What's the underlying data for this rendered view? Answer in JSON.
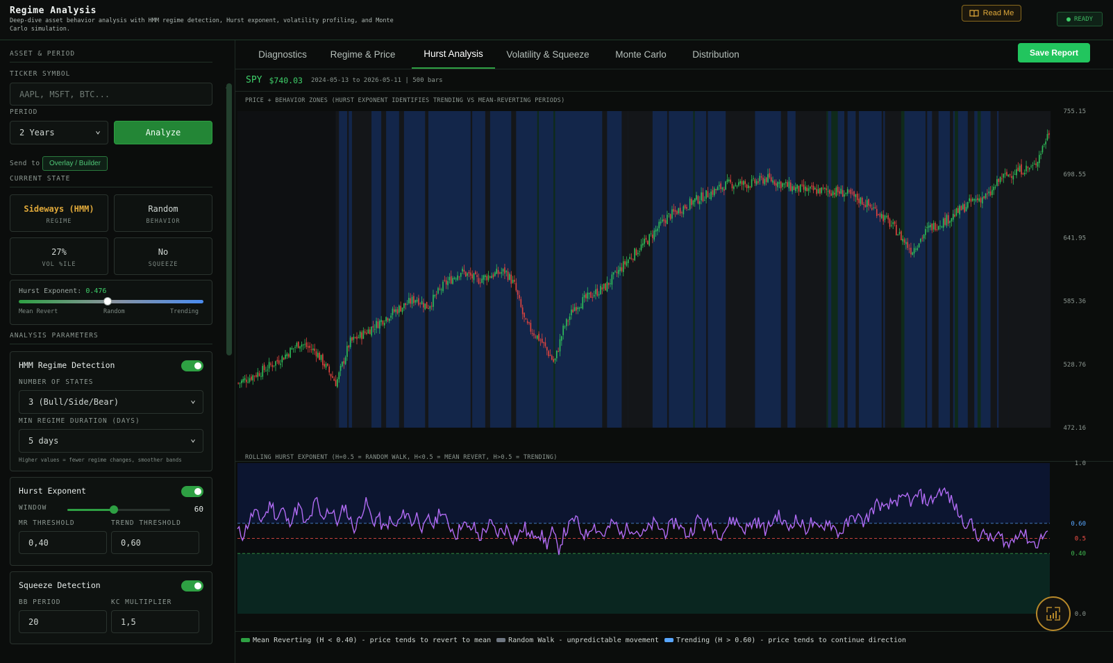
{
  "header": {
    "title": "Regime Analysis",
    "subtitle": "Deep-dive asset behavior analysis with HMM regime detection, Hurst exponent, volatility profiling, and Monte Carlo simulation.",
    "readme_label": "Read Me",
    "status_label": "READY"
  },
  "sidebar": {
    "asset_section": "ASSET & PERIOD",
    "ticker_label": "TICKER SYMBOL",
    "ticker_placeholder": "AAPL, MSFT, BTC...",
    "period_label": "PERIOD",
    "period_value": "2 Years",
    "analyze_label": "Analyze",
    "send_to_label": "Send to",
    "send_to_chip": "Overlay / Builder",
    "state_section": "CURRENT STATE",
    "state_cards": [
      {
        "value": "Sideways (HMM)",
        "label": "REGIME",
        "color": "#e0a93a"
      },
      {
        "value": "Random",
        "label": "BEHAVIOR",
        "color": "#cfd6d2"
      },
      {
        "value": "27%",
        "label": "VOL %ILE",
        "color": "#cfd6d2"
      },
      {
        "value": "No",
        "label": "SQUEEZE",
        "color": "#cfd6d2"
      }
    ],
    "hurst_gauge": {
      "label": "Hurst Exponent:",
      "value": "0.476",
      "position": 0.476,
      "left_label": "Mean Revert",
      "mid_label": "Random",
      "right_label": "Trending"
    },
    "params_section": "ANALYSIS PARAMETERS",
    "hmm": {
      "title": "HMM Regime Detection",
      "enabled": true,
      "states_label": "NUMBER OF STATES",
      "states_value": "3 (Bull/Side/Bear)",
      "duration_label": "MIN REGIME DURATION (DAYS)",
      "duration_value": "5 days",
      "hint": "Higher values = fewer regime changes, smoother bands"
    },
    "hurst": {
      "title": "Hurst Exponent",
      "enabled": true,
      "window_label": "WINDOW",
      "window_value": "60",
      "window_fraction": 0.45,
      "mr_label": "MR THRESHOLD",
      "mr_value": "0,40",
      "trend_label": "TREND THRESHOLD",
      "trend_value": "0,60"
    },
    "squeeze": {
      "title": "Squeeze Detection",
      "enabled": true,
      "bb_label": "BB PERIOD",
      "bb_value": "20",
      "kc_label": "KC MULTIPLIER",
      "kc_value": "1,5"
    }
  },
  "tabs": [
    {
      "label": "Diagnostics",
      "active": false
    },
    {
      "label": "Regime & Price",
      "active": false
    },
    {
      "label": "Hurst Analysis",
      "active": true
    },
    {
      "label": "Volatility & Squeeze",
      "active": false
    },
    {
      "label": "Monte Carlo",
      "active": false
    },
    {
      "label": "Distribution",
      "active": false
    }
  ],
  "save_label": "Save Report",
  "info": {
    "ticker": "SPY",
    "price": "$740.03",
    "range": "2024-05-13 to 2026-05-11 | 500 bars"
  },
  "legend": {
    "items": [
      {
        "label": "Mean Reverting (H < 0.40) - price tends to revert to mean",
        "color": "#2ea043"
      },
      {
        "label": "Random Walk - unpredictable movement",
        "color": "#6e7681"
      },
      {
        "label": "Trending (H > 0.60) - price tends to continue direction",
        "color": "#58a6ff"
      }
    ]
  },
  "chart_data": [
    {
      "type": "candlestick",
      "title": "PRICE + BEHAVIOR ZONES (HURST EXPONENT IDENTIFIES TRENDING VS MEAN-REVERTING PERIODS)",
      "ylim": [
        472.16,
        755.15
      ],
      "ytick_labels": [
        "755.15",
        "698.55",
        "641.95",
        "585.36",
        "528.76",
        "472.16"
      ],
      "bars": 500,
      "anchor_closes": [
        [
          0,
          512
        ],
        [
          20,
          522
        ],
        [
          40,
          535
        ],
        [
          55,
          548
        ],
        [
          70,
          540
        ],
        [
          88,
          512
        ],
        [
          100,
          548
        ],
        [
          118,
          560
        ],
        [
          140,
          576
        ],
        [
          160,
          588
        ],
        [
          170,
          580
        ],
        [
          185,
          600
        ],
        [
          200,
          612
        ],
        [
          215,
          604
        ],
        [
          225,
          608
        ],
        [
          240,
          612
        ],
        [
          248,
          600
        ],
        [
          258,
          565
        ],
        [
          272,
          550
        ],
        [
          284,
          530
        ],
        [
          292,
          560
        ],
        [
          302,
          580
        ],
        [
          316,
          590
        ],
        [
          330,
          598
        ],
        [
          350,
          622
        ],
        [
          368,
          640
        ],
        [
          385,
          660
        ],
        [
          398,
          668
        ],
        [
          410,
          675
        ],
        [
          420,
          680
        ],
        [
          440,
          690
        ],
        [
          460,
          690
        ],
        [
          475,
          695
        ],
        [
          488,
          690
        ],
        [
          500,
          686
        ],
        [
          515,
          684
        ],
        [
          530,
          684
        ],
        [
          545,
          682
        ],
        [
          560,
          675
        ],
        [
          575,
          665
        ],
        [
          590,
          650
        ],
        [
          605,
          630
        ],
        [
          620,
          650
        ],
        [
          640,
          660
        ],
        [
          660,
          675
        ],
        [
          675,
          680
        ],
        [
          685,
          695
        ],
        [
          700,
          702
        ],
        [
          715,
          705
        ],
        [
          730,
          740
        ]
      ],
      "zones": {
        "trending_color": "#13264a",
        "random_color": "#141619",
        "mean_revert_color": "#0f2a1a"
      }
    },
    {
      "type": "line",
      "title": "ROLLING HURST EXPONENT (H=0.5 = RANDOM WALK, H<0.5 = MEAN REVERT, H>0.5 = TRENDING)",
      "ylim": [
        0.0,
        1.0
      ],
      "ytick_labels": [
        "1.0",
        "0.0"
      ],
      "threshold_labels": [
        {
          "label": "0.60",
          "value": 0.6,
          "color": "#58a6ff"
        },
        {
          "label": "0.5",
          "value": 0.5,
          "color": "#f85149"
        },
        {
          "label": "0.40",
          "value": 0.4,
          "color": "#3fb950"
        }
      ],
      "series": [
        {
          "color": "#b26cf5",
          "values": [
            0.55,
            0.52,
            0.61,
            0.68,
            0.62,
            0.66,
            0.74,
            0.63,
            0.7,
            0.6,
            0.66,
            0.72,
            0.58,
            0.64,
            0.76,
            0.62,
            0.7,
            0.66,
            0.6,
            0.73,
            0.62,
            0.56,
            0.68,
            0.74,
            0.6,
            0.65,
            0.55,
            0.62,
            0.57,
            0.63,
            0.68,
            0.6,
            0.66,
            0.55,
            0.63,
            0.58,
            0.7,
            0.62,
            0.57,
            0.52,
            0.62,
            0.55,
            0.58,
            0.5,
            0.56,
            0.6,
            0.53,
            0.55,
            0.57,
            0.5,
            0.52,
            0.58,
            0.5,
            0.55,
            0.52,
            0.46,
            0.55,
            0.42,
            0.53,
            0.58,
            0.64,
            0.55,
            0.52,
            0.6,
            0.56,
            0.52,
            0.57,
            0.61,
            0.52,
            0.56,
            0.58,
            0.55,
            0.52,
            0.56,
            0.6,
            0.57,
            0.54,
            0.58,
            0.62,
            0.56,
            0.52,
            0.57,
            0.64,
            0.58,
            0.6,
            0.55,
            0.53,
            0.58,
            0.63,
            0.6,
            0.56,
            0.58,
            0.62,
            0.59,
            0.55,
            0.61,
            0.66,
            0.6,
            0.57,
            0.63,
            0.6,
            0.56,
            0.61,
            0.55,
            0.58,
            0.62,
            0.57,
            0.53,
            0.58,
            0.62,
            0.66,
            0.6,
            0.64,
            0.7,
            0.74,
            0.68,
            0.72,
            0.76,
            0.74,
            0.78,
            0.73,
            0.8,
            0.76,
            0.74,
            0.78,
            0.82,
            0.8,
            0.74,
            0.68,
            0.6,
            0.62,
            0.55,
            0.5,
            0.54,
            0.48,
            0.52,
            0.5,
            0.45,
            0.5,
            0.56,
            0.52,
            0.48,
            0.46,
            0.51,
            0.55
          ]
        }
      ]
    }
  ]
}
